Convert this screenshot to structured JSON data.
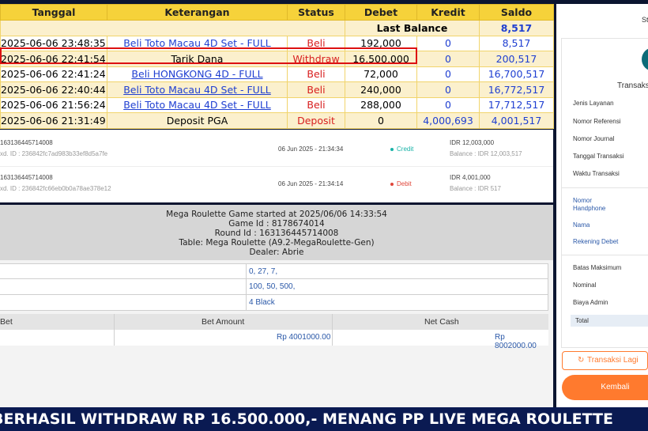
{
  "top_table": {
    "headers": [
      "Tanggal",
      "Keterangan",
      "Status",
      "Debet",
      "Kredit",
      "Saldo"
    ],
    "last_balance_label": "Last Balance",
    "last_balance_value": "8,517",
    "rows": [
      {
        "date": "2025-06-06 23:48:35",
        "desc": "Beli Toto Macau 4D Set - FULL",
        "status": "Beli",
        "debet": "192,000",
        "kredit": "0",
        "saldo": "8,517",
        "link": true
      },
      {
        "date": "2025-06-06 22:41:54",
        "desc": "Tarik Dana",
        "status": "Withdraw",
        "debet": "16,500,000",
        "kredit": "0",
        "saldo": "200,517",
        "link": false
      },
      {
        "date": "2025-06-06 22:41:24",
        "desc": "Beli HONGKONG 4D - FULL",
        "status": "Beli",
        "debet": "72,000",
        "kredit": "0",
        "saldo": "16,700,517",
        "link": true
      },
      {
        "date": "2025-06-06 22:40:44",
        "desc": "Beli Toto Macau 4D Set - FULL",
        "status": "Beli",
        "debet": "240,000",
        "kredit": "0",
        "saldo": "16,772,517",
        "link": true
      },
      {
        "date": "2025-06-06 21:56:24",
        "desc": "Beli Toto Macau 4D Set - FULL",
        "status": "Beli",
        "debet": "288,000",
        "kredit": "0",
        "saldo": "17,712,517",
        "link": true
      },
      {
        "date": "2025-06-06 21:31:49",
        "desc": "Deposit PGA",
        "status": "Deposit",
        "debet": "0",
        "kredit": "4,000,693",
        "saldo": "4,001,517",
        "link": false
      }
    ]
  },
  "history": [
    {
      "id": "163136445714008",
      "sub": "xd. ID : 236842fc7ad983b33ef8d5a7fe",
      "date": "06 Jun 2025 - 21:34:34",
      "type": "Credit",
      "amount": "IDR 12,003,000",
      "balance": "Balance : IDR 12,003,517"
    },
    {
      "id": "163136445714008",
      "sub": "xd. ID : 236842fc66eb0b0a78ae378e12",
      "date": "06 Jun 2025 - 21:34:14",
      "type": "Debit",
      "amount": "IDR 4,001,000",
      "balance": "Balance : IDR 517"
    }
  ],
  "game": {
    "lines": [
      "Mega Roulette Game started at 2025/06/06 14:33:54",
      "Game Id : 8178674014",
      "Round Id : 163136445714008",
      "Table: Mega Roulette (A9.2-MegaRoulette-Gen)",
      "Dealer: Abrie"
    ],
    "values": [
      "0, 27, 7,",
      "100, 50, 500,",
      "4 Black"
    ],
    "bet_headers": [
      "Bet",
      "Bet Amount",
      "Net Cash"
    ],
    "bet_amount": "Rp 4001000.00",
    "net_cash": "Rp 8002000.00"
  },
  "right_panel": {
    "status_fragment": "St",
    "title_fragment": "Transaks",
    "labels": [
      "Jenis Layanan",
      "Nomor Referensi",
      "Nomor Journal",
      "Tanggal Transaksi",
      "Waktu Transaksi"
    ],
    "labels2": [
      "Nomor Handphone",
      "Nama",
      "Rekening Debet"
    ],
    "labels3": [
      "Batas Maksimum",
      "Nominal",
      "Biaya Admin",
      "Total"
    ],
    "btn_again": "Transaksi Lagi",
    "btn_back": "Kembali"
  },
  "banner": "BERHASIL WITHDRAW RP 16.500.000,- MENANG PP LIVE MEGA ROULETTE",
  "colors": {
    "header_yellow": "#f6d23a",
    "link_blue": "#1f3fd1",
    "status_red": "#d81e1e",
    "orange": "#ff7a2e",
    "credit": "#19b3a8",
    "debit": "#e0463a"
  }
}
